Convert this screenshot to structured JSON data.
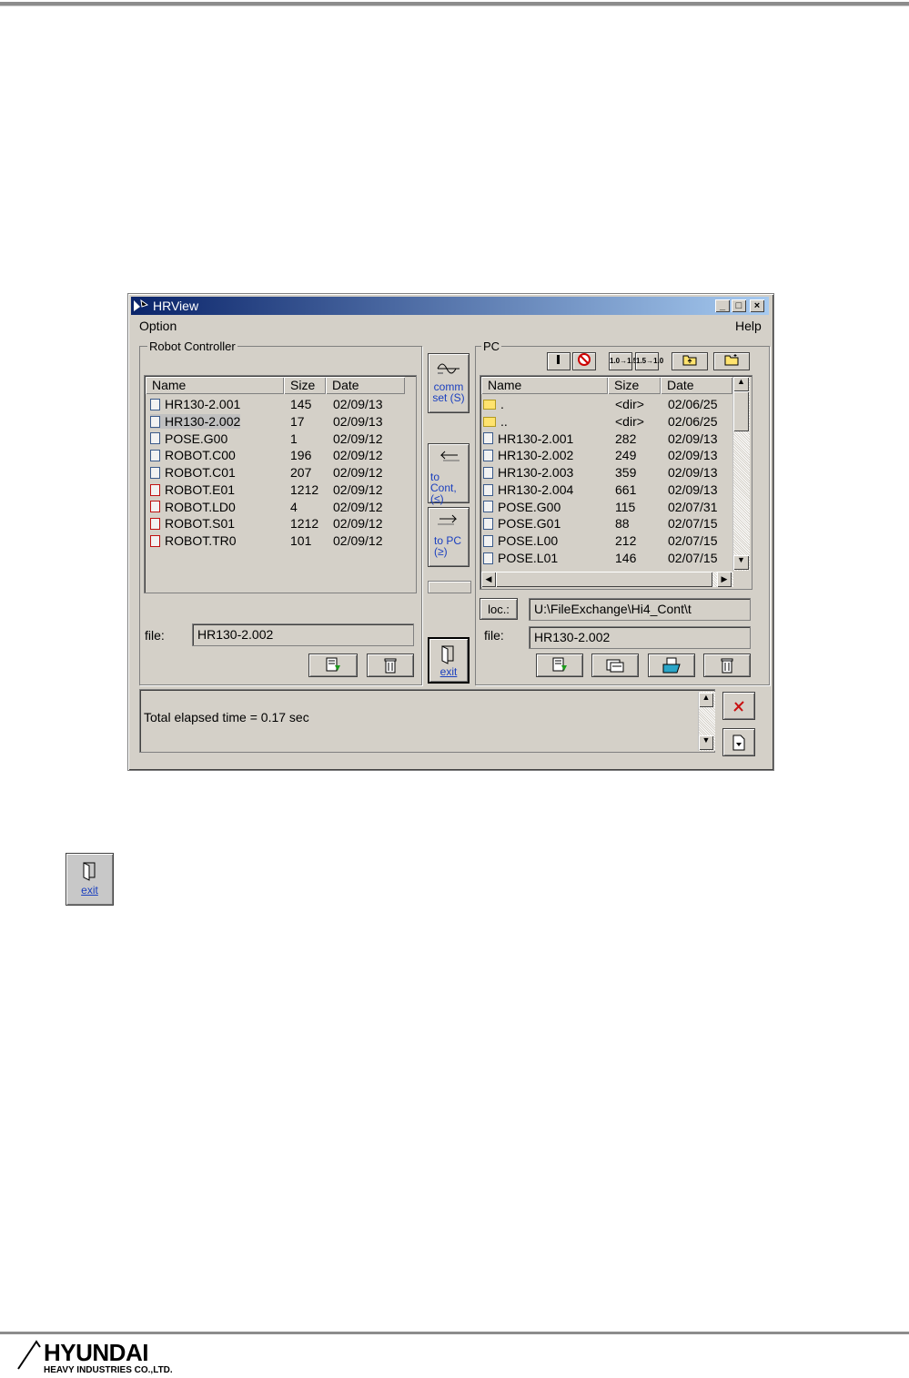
{
  "window": {
    "title": "HRView"
  },
  "menu": {
    "option": "Option",
    "help": "Help"
  },
  "robot_controller": {
    "group_label": "Robot Controller",
    "columns": [
      "Name",
      "Size",
      "Date"
    ],
    "files": [
      {
        "name": "HR130-2.001",
        "size": "145",
        "date": "02/09/13",
        "icon": "job-file-icon"
      },
      {
        "name": "HR130-2.002",
        "size": "17",
        "date": "02/09/13",
        "icon": "job-file-icon"
      },
      {
        "name": "POSE.G00",
        "size": "1",
        "date": "02/09/12",
        "icon": "pose-file-icon"
      },
      {
        "name": "ROBOT.C00",
        "size": "196",
        "date": "02/09/12",
        "icon": "constant-file-icon"
      },
      {
        "name": "ROBOT.C01",
        "size": "207",
        "date": "02/09/12",
        "icon": "constant-file-icon"
      },
      {
        "name": "ROBOT.E01",
        "size": "1212",
        "date": "02/09/12",
        "icon": "system-file-icon"
      },
      {
        "name": "ROBOT.LD0",
        "size": "4",
        "date": "02/09/12",
        "icon": "system-file-icon"
      },
      {
        "name": "ROBOT.S01",
        "size": "1212",
        "date": "02/09/12",
        "icon": "system-file-icon"
      },
      {
        "name": "ROBOT.TR0",
        "size": "101",
        "date": "02/09/12",
        "icon": "system-file-icon"
      }
    ],
    "file_label": "file:",
    "file_value": "HR130-2.002"
  },
  "middle": {
    "comm_set": "comm set (S)",
    "to_cont": "to Cont,(≤)",
    "to_pc": "to PC (≥)",
    "exit": "exit"
  },
  "pc": {
    "group_label": "PC",
    "columns": [
      "Name",
      "Size",
      "Date"
    ],
    "files": [
      {
        "name": ".",
        "size": "<dir>",
        "date": "02/06/25",
        "icon": "folder-icon"
      },
      {
        "name": "..",
        "size": "<dir>",
        "date": "02/06/25",
        "icon": "folder-icon"
      },
      {
        "name": "HR130-2.001",
        "size": "282",
        "date": "02/09/13",
        "icon": "job-file-icon"
      },
      {
        "name": "HR130-2.002",
        "size": "249",
        "date": "02/09/13",
        "icon": "job-file-icon"
      },
      {
        "name": "HR130-2.003",
        "size": "359",
        "date": "02/09/13",
        "icon": "job-file-icon"
      },
      {
        "name": "HR130-2.004",
        "size": "661",
        "date": "02/09/13",
        "icon": "job-file-icon"
      },
      {
        "name": "POSE.G00",
        "size": "115",
        "date": "02/07/31",
        "icon": "pose-file-icon"
      },
      {
        "name": "POSE.G01",
        "size": "88",
        "date": "02/07/15",
        "icon": "pose-file-icon"
      },
      {
        "name": "POSE.L00",
        "size": "212",
        "date": "02/07/15",
        "icon": "pose-file-icon"
      },
      {
        "name": "POSE.L01",
        "size": "146",
        "date": "02/07/15",
        "icon": "pose-file-icon"
      }
    ],
    "toolbar": [
      "1.0→1.5",
      "1.5→1.0"
    ],
    "loc_label": "loc.:",
    "loc_value": "U:\\FileExchange\\Hi4_Cont\\t",
    "file_label": "file:",
    "file_value": "HR130-2.002"
  },
  "status": {
    "message": "Total elapsed time = 0.17 sec"
  },
  "legend": {
    "exit_label": "exit"
  },
  "footer": {
    "brand": "HYUNDAI",
    "company": "HEAVY INDUSTRIES CO.,LTD."
  },
  "colors": {
    "titlebar": "#0a246a",
    "face": "#d4d0c8",
    "link_blue": "#1a3fbf"
  }
}
